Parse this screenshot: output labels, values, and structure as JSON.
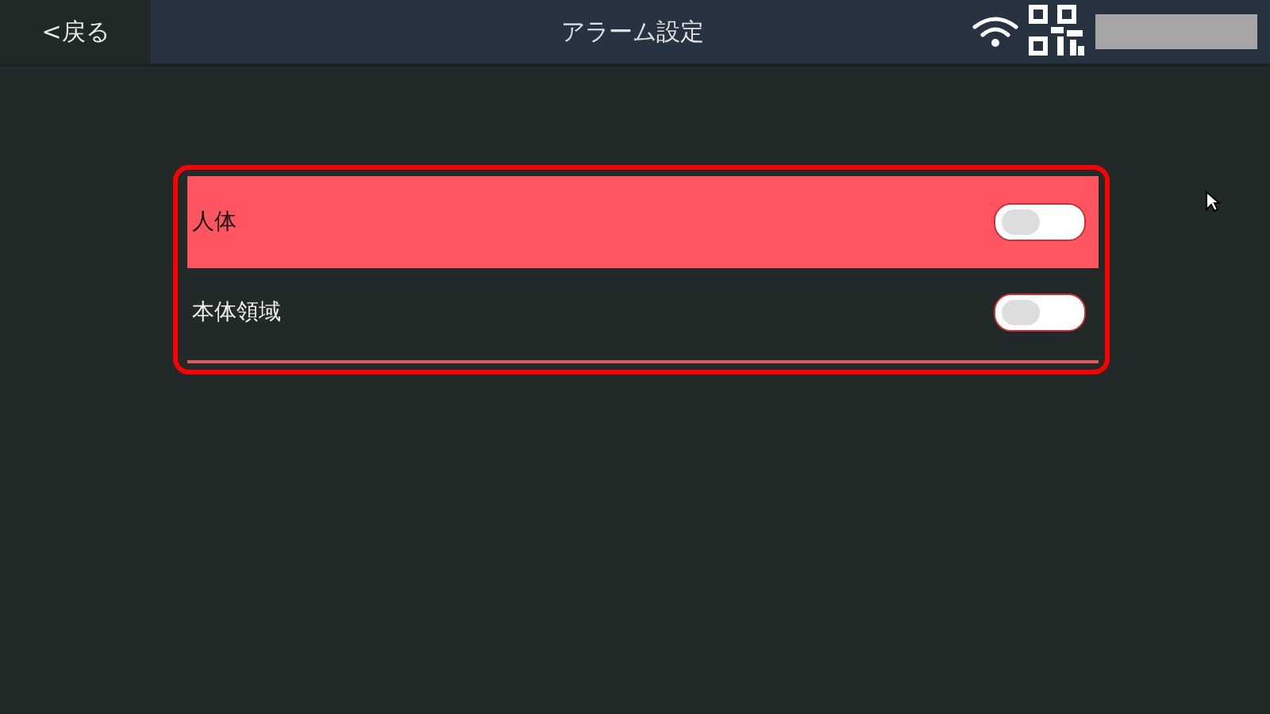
{
  "header": {
    "back_button": "<戻る",
    "title": "アラーム設定"
  },
  "alarms": [
    {
      "label": "人体",
      "selected": true,
      "on": false
    },
    {
      "label": "本体領域",
      "selected": false,
      "on": false
    }
  ]
}
